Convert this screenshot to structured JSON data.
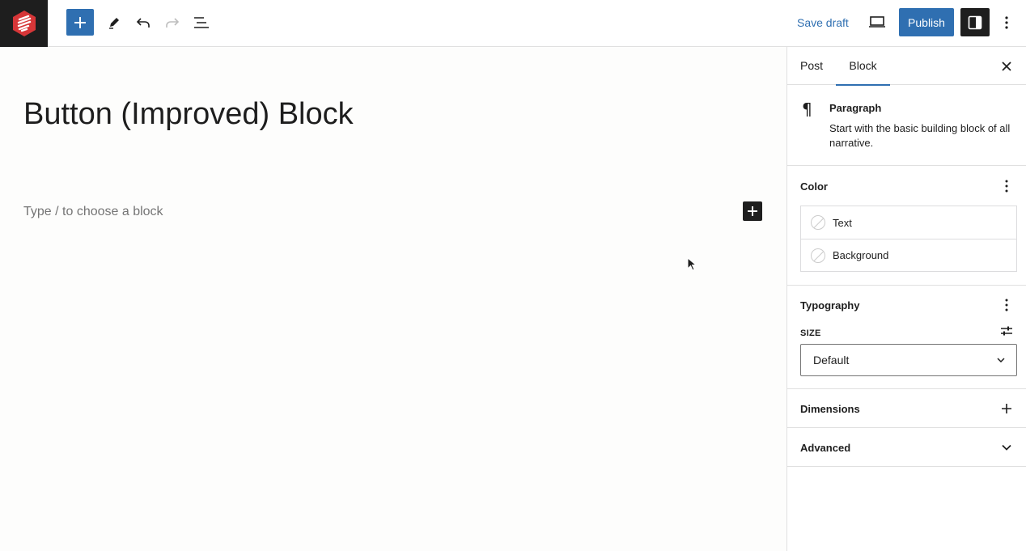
{
  "toolbar": {
    "add_block_icon": "plus-icon",
    "tools_icon": "pencil-icon",
    "undo_icon": "undo-icon",
    "redo_icon": "redo-icon",
    "list_view_icon": "list-view-icon",
    "save_draft_label": "Save draft",
    "preview_icon": "laptop-icon",
    "publish_label": "Publish",
    "settings_icon": "sidebar-icon",
    "options_icon": "kebab-icon"
  },
  "canvas": {
    "title": "Button (Improved) Block",
    "placeholder": "Type / to choose a block"
  },
  "sidebar": {
    "tabs": [
      {
        "label": "Post"
      },
      {
        "label": "Block"
      }
    ],
    "active_tab": "Block",
    "block": {
      "icon": "paragraph-icon",
      "name": "Paragraph",
      "description": "Start with the basic building block of all narrative."
    },
    "color": {
      "title": "Color",
      "items": [
        {
          "label": "Text"
        },
        {
          "label": "Background"
        }
      ]
    },
    "typography": {
      "title": "Typography",
      "size_label": "SIZE",
      "size_value": "Default"
    },
    "dimensions": {
      "title": "Dimensions"
    },
    "advanced": {
      "title": "Advanced"
    }
  },
  "colors": {
    "accent": "#2f6fb1",
    "dark": "#1e1e1e",
    "logo": "#d63638"
  }
}
